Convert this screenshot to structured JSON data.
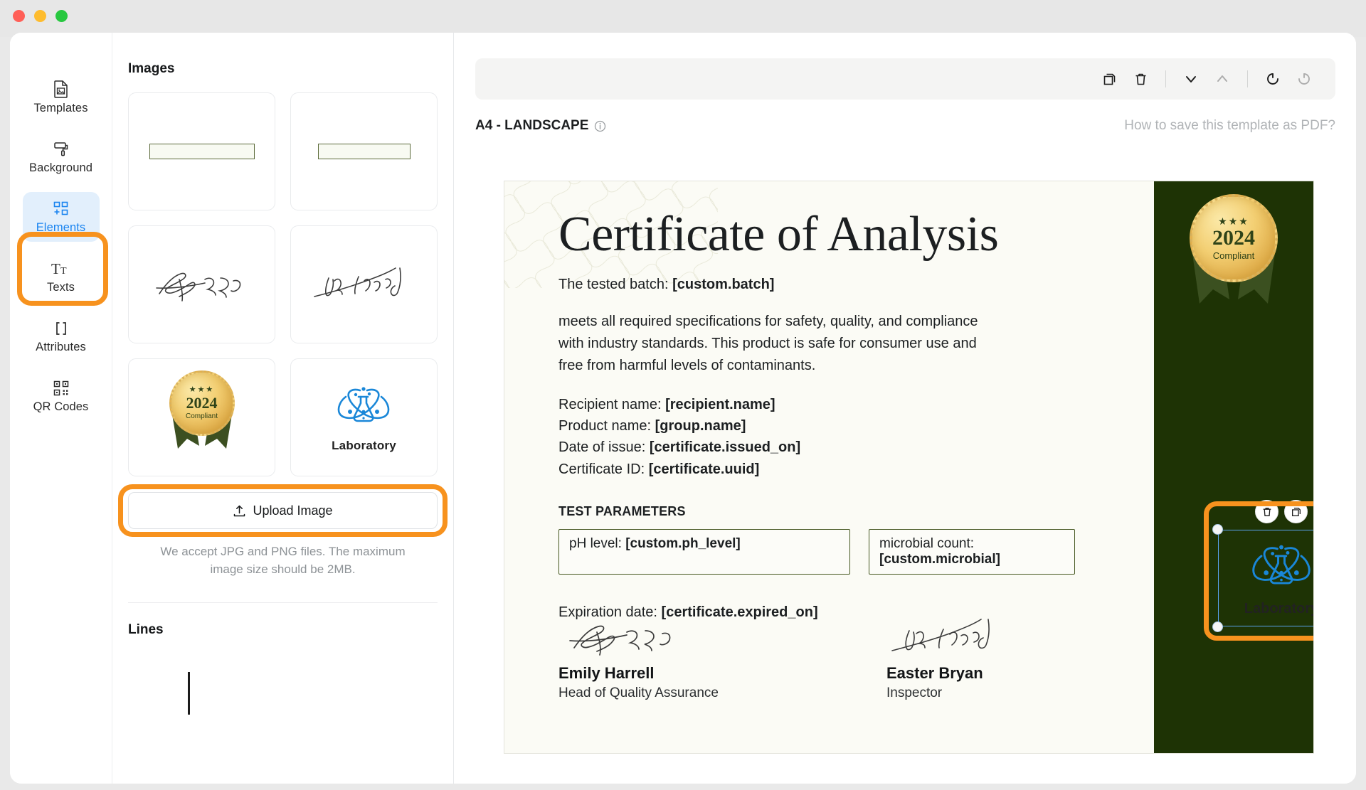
{
  "window": {
    "traffic_lights": [
      "close",
      "minimize",
      "maximize"
    ]
  },
  "sidebar": {
    "items": [
      {
        "label": "Templates",
        "icon": "document-image-icon",
        "active": false
      },
      {
        "label": "Background",
        "icon": "paint-roller-icon",
        "active": false
      },
      {
        "label": "Elements",
        "icon": "add-element-icon",
        "active": true
      },
      {
        "label": "Texts",
        "icon": "text-format-icon",
        "active": false
      },
      {
        "label": "Attributes",
        "icon": "brackets-icon",
        "active": false
      },
      {
        "label": "QR Codes",
        "icon": "qr-code-icon",
        "active": false
      }
    ],
    "highlight_color": "#f7921e",
    "active_color": "#1a84f0"
  },
  "images_panel": {
    "heading": "Images",
    "thumbnails": [
      {
        "name": "line-box-wide",
        "kind": "line-box"
      },
      {
        "name": "line-box-narrow",
        "kind": "line-box"
      },
      {
        "name": "signature-steven",
        "kind": "signature"
      },
      {
        "name": "signature-john",
        "kind": "signature"
      },
      {
        "name": "award-badge",
        "kind": "badge"
      },
      {
        "name": "laboratory-logo",
        "kind": "lab",
        "label": "Laboratory"
      }
    ],
    "upload": {
      "label": "Upload Image",
      "icon": "upload-icon",
      "hint": "We accept JPG and PNG files. The maximum image size should be 2MB."
    },
    "lines_heading": "Lines"
  },
  "toolbar": {
    "buttons": [
      {
        "name": "duplicate",
        "icon": "copy-icon",
        "disabled": false
      },
      {
        "name": "delete",
        "icon": "trash-icon",
        "disabled": false
      },
      {
        "name": "separator-1",
        "icon": "separator",
        "disabled": false
      },
      {
        "name": "move-down",
        "icon": "chevron-down-icon",
        "disabled": false
      },
      {
        "name": "move-up",
        "icon": "chevron-up-icon",
        "disabled": true
      },
      {
        "name": "separator-2",
        "icon": "separator",
        "disabled": false
      },
      {
        "name": "undo",
        "icon": "undo-icon",
        "disabled": false
      },
      {
        "name": "redo",
        "icon": "redo-icon",
        "disabled": true
      }
    ]
  },
  "page_meta": {
    "format": "A4 - LANDSCAPE",
    "info_icon": "info-icon",
    "save_link": "How to save this template as PDF?"
  },
  "certificate": {
    "title": "Certificate of Analysis",
    "batch_label": "The tested batch:",
    "batch_token": "[custom.batch]",
    "paragraph": "meets all required specifications for safety, quality, and compliance with industry standards. This product is safe for consumer use and free from harmful levels of contaminants.",
    "fields": [
      {
        "label": "Recipient name:",
        "token": "[recipient.name]"
      },
      {
        "label": "Product name:",
        "token": "[group.name]"
      },
      {
        "label": "Date of issue:",
        "token": "[certificate.issued_on]"
      },
      {
        "label": "Certificate ID:",
        "token": "[certificate.uuid]"
      }
    ],
    "test_parameters_title": "TEST PARAMETERS",
    "parameters": [
      {
        "label": "pH level:",
        "token": "[custom.ph_level]"
      },
      {
        "label": "microbial count:",
        "token": "[custom.microbial]"
      }
    ],
    "expiration_label": "Expiration date:",
    "expiration_token": "[certificate.expired_on]",
    "signatures": [
      {
        "name": "Emily Harrell",
        "role": "Head of Quality Assurance"
      },
      {
        "name": "Easter Bryan",
        "role": "Inspector"
      }
    ],
    "badge": {
      "stars": "★★★",
      "year": "2024",
      "subtitle": "Compliant"
    },
    "colors": {
      "paper": "#fbfbf5",
      "green_bar": "#1e3305",
      "param_border": "#44561f",
      "gold": "#f3cf73"
    }
  },
  "selected_element": {
    "label": "Laboratory",
    "actions": [
      {
        "name": "delete",
        "icon": "trash-icon"
      },
      {
        "name": "duplicate",
        "icon": "copy-icon"
      }
    ],
    "handles": [
      "top-left",
      "top-right",
      "bottom-left",
      "bottom-right"
    ],
    "frame_color": "#5aa3f0",
    "highlight_color": "#f7921e"
  }
}
